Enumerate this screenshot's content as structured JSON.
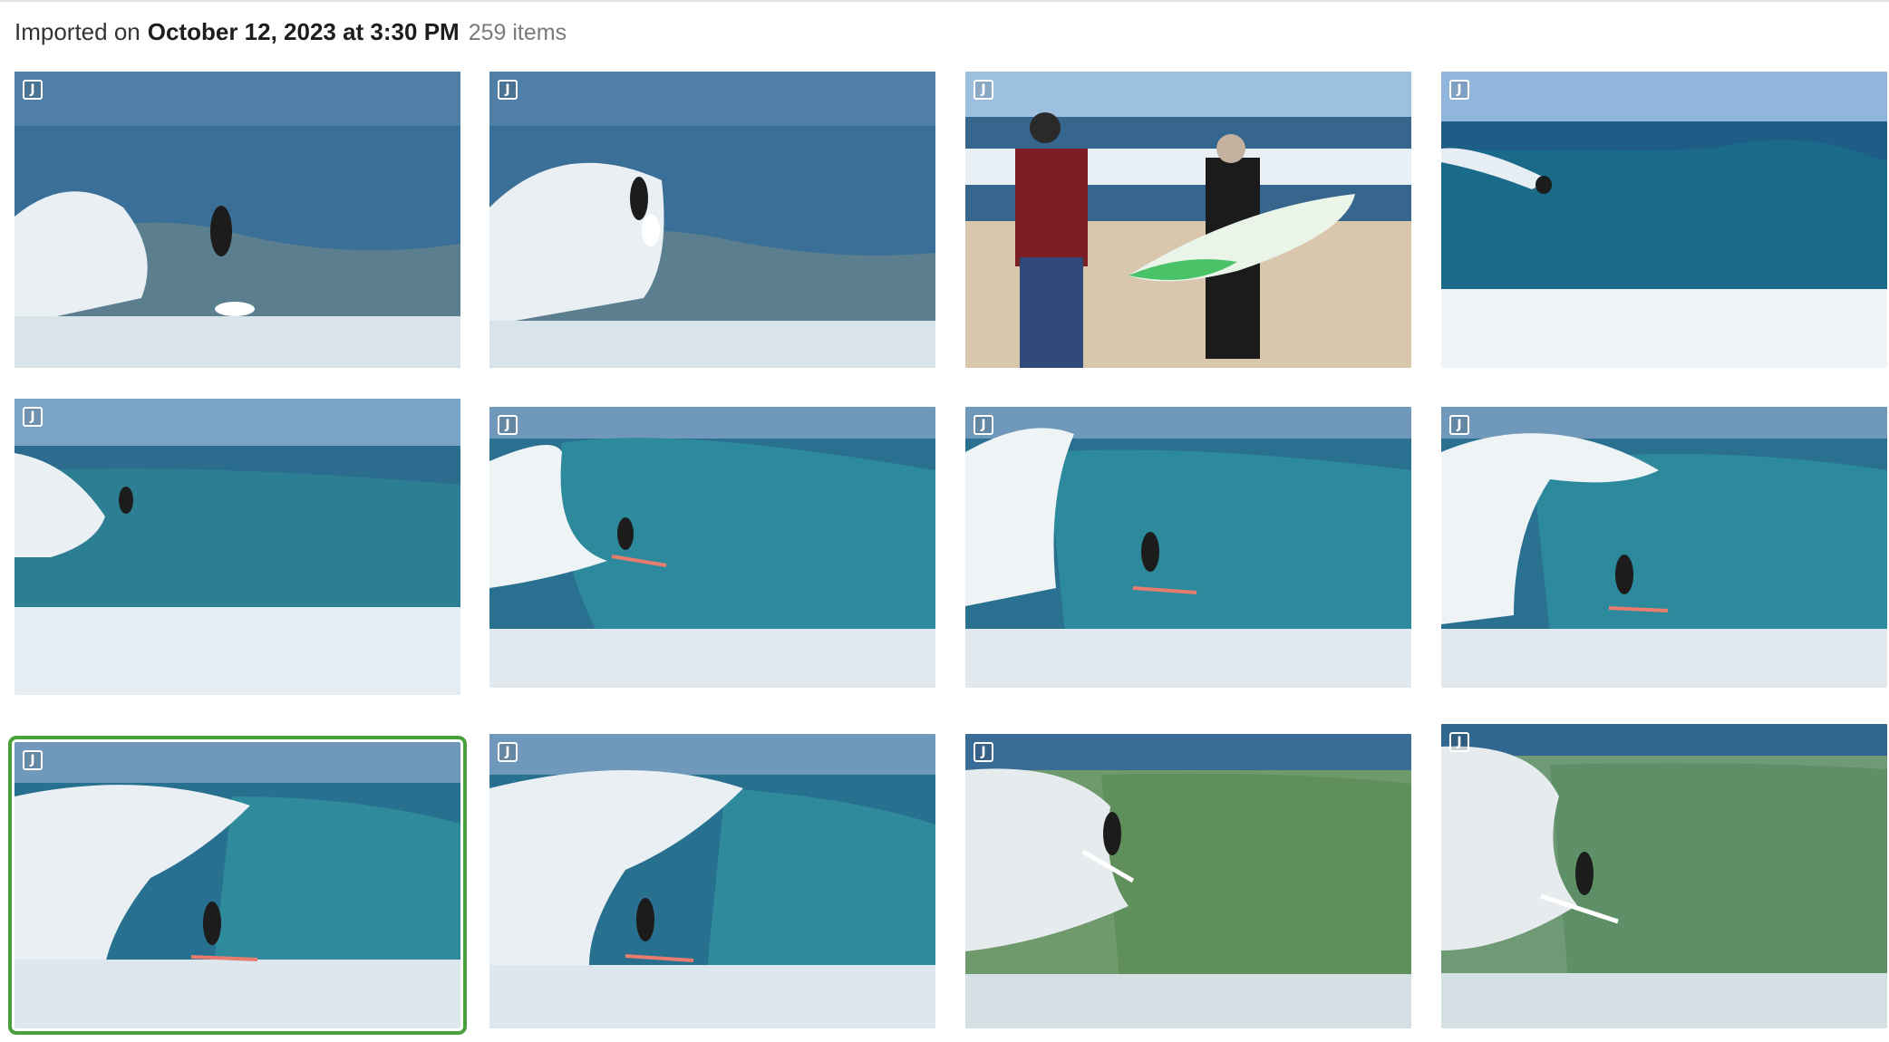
{
  "header": {
    "prefix": "Imported on",
    "date": "October 12, 2023 at 3:30 PM",
    "count": "259 items"
  },
  "badge_label": "J",
  "colors": {
    "selection": "#4aa03b",
    "sky": "#8fb2d6",
    "ocean": "#2b6c8f",
    "wave_face": "#2e8197",
    "foam": "#eef3f6",
    "sand": "#d8c6ad"
  },
  "photos": [
    {
      "kind": "surf",
      "scene": "cutback",
      "selected": false
    },
    {
      "kind": "surf",
      "scene": "cutback",
      "selected": false
    },
    {
      "kind": "beach",
      "scene": "two-men-talking",
      "selected": false
    },
    {
      "kind": "surf",
      "scene": "distant",
      "selected": false
    },
    {
      "kind": "surf",
      "scene": "barrel",
      "selected": false
    },
    {
      "kind": "surf",
      "scene": "barrel",
      "selected": false
    },
    {
      "kind": "surf",
      "scene": "barrel",
      "selected": false
    },
    {
      "kind": "surf",
      "scene": "barrel",
      "selected": false
    },
    {
      "kind": "surf",
      "scene": "barrel",
      "selected": true
    },
    {
      "kind": "surf",
      "scene": "barrel",
      "selected": false
    },
    {
      "kind": "surf",
      "scene": "green-wave",
      "selected": false
    },
    {
      "kind": "surf",
      "scene": "green-wave",
      "selected": false
    }
  ]
}
